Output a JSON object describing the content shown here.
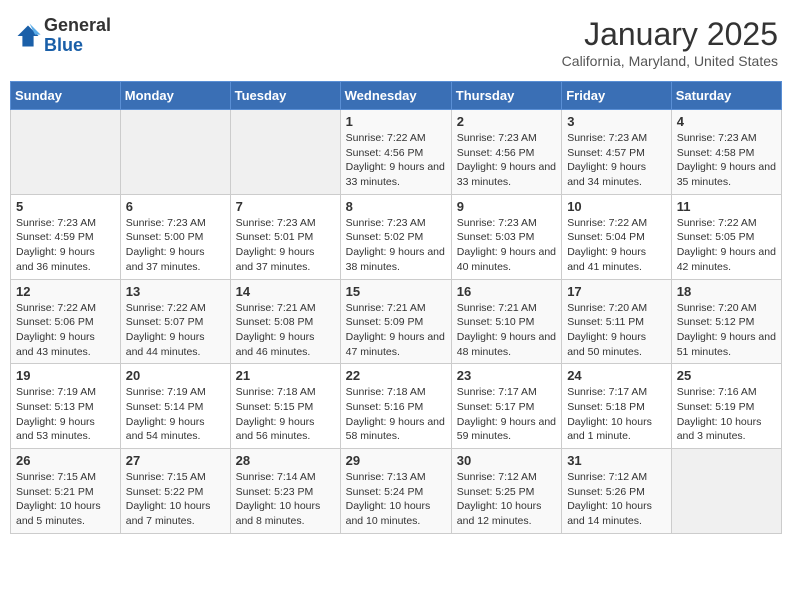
{
  "header": {
    "logo_general": "General",
    "logo_blue": "Blue",
    "month_title": "January 2025",
    "location": "California, Maryland, United States"
  },
  "weekdays": [
    "Sunday",
    "Monday",
    "Tuesday",
    "Wednesday",
    "Thursday",
    "Friday",
    "Saturday"
  ],
  "weeks": [
    [
      {
        "day": "",
        "info": ""
      },
      {
        "day": "",
        "info": ""
      },
      {
        "day": "",
        "info": ""
      },
      {
        "day": "1",
        "info": "Sunrise: 7:22 AM\nSunset: 4:56 PM\nDaylight: 9 hours and 33 minutes."
      },
      {
        "day": "2",
        "info": "Sunrise: 7:23 AM\nSunset: 4:56 PM\nDaylight: 9 hours and 33 minutes."
      },
      {
        "day": "3",
        "info": "Sunrise: 7:23 AM\nSunset: 4:57 PM\nDaylight: 9 hours and 34 minutes."
      },
      {
        "day": "4",
        "info": "Sunrise: 7:23 AM\nSunset: 4:58 PM\nDaylight: 9 hours and 35 minutes."
      }
    ],
    [
      {
        "day": "5",
        "info": "Sunrise: 7:23 AM\nSunset: 4:59 PM\nDaylight: 9 hours and 36 minutes."
      },
      {
        "day": "6",
        "info": "Sunrise: 7:23 AM\nSunset: 5:00 PM\nDaylight: 9 hours and 37 minutes."
      },
      {
        "day": "7",
        "info": "Sunrise: 7:23 AM\nSunset: 5:01 PM\nDaylight: 9 hours and 37 minutes."
      },
      {
        "day": "8",
        "info": "Sunrise: 7:23 AM\nSunset: 5:02 PM\nDaylight: 9 hours and 38 minutes."
      },
      {
        "day": "9",
        "info": "Sunrise: 7:23 AM\nSunset: 5:03 PM\nDaylight: 9 hours and 40 minutes."
      },
      {
        "day": "10",
        "info": "Sunrise: 7:22 AM\nSunset: 5:04 PM\nDaylight: 9 hours and 41 minutes."
      },
      {
        "day": "11",
        "info": "Sunrise: 7:22 AM\nSunset: 5:05 PM\nDaylight: 9 hours and 42 minutes."
      }
    ],
    [
      {
        "day": "12",
        "info": "Sunrise: 7:22 AM\nSunset: 5:06 PM\nDaylight: 9 hours and 43 minutes."
      },
      {
        "day": "13",
        "info": "Sunrise: 7:22 AM\nSunset: 5:07 PM\nDaylight: 9 hours and 44 minutes."
      },
      {
        "day": "14",
        "info": "Sunrise: 7:21 AM\nSunset: 5:08 PM\nDaylight: 9 hours and 46 minutes."
      },
      {
        "day": "15",
        "info": "Sunrise: 7:21 AM\nSunset: 5:09 PM\nDaylight: 9 hours and 47 minutes."
      },
      {
        "day": "16",
        "info": "Sunrise: 7:21 AM\nSunset: 5:10 PM\nDaylight: 9 hours and 48 minutes."
      },
      {
        "day": "17",
        "info": "Sunrise: 7:20 AM\nSunset: 5:11 PM\nDaylight: 9 hours and 50 minutes."
      },
      {
        "day": "18",
        "info": "Sunrise: 7:20 AM\nSunset: 5:12 PM\nDaylight: 9 hours and 51 minutes."
      }
    ],
    [
      {
        "day": "19",
        "info": "Sunrise: 7:19 AM\nSunset: 5:13 PM\nDaylight: 9 hours and 53 minutes."
      },
      {
        "day": "20",
        "info": "Sunrise: 7:19 AM\nSunset: 5:14 PM\nDaylight: 9 hours and 54 minutes."
      },
      {
        "day": "21",
        "info": "Sunrise: 7:18 AM\nSunset: 5:15 PM\nDaylight: 9 hours and 56 minutes."
      },
      {
        "day": "22",
        "info": "Sunrise: 7:18 AM\nSunset: 5:16 PM\nDaylight: 9 hours and 58 minutes."
      },
      {
        "day": "23",
        "info": "Sunrise: 7:17 AM\nSunset: 5:17 PM\nDaylight: 9 hours and 59 minutes."
      },
      {
        "day": "24",
        "info": "Sunrise: 7:17 AM\nSunset: 5:18 PM\nDaylight: 10 hours and 1 minute."
      },
      {
        "day": "25",
        "info": "Sunrise: 7:16 AM\nSunset: 5:19 PM\nDaylight: 10 hours and 3 minutes."
      }
    ],
    [
      {
        "day": "26",
        "info": "Sunrise: 7:15 AM\nSunset: 5:21 PM\nDaylight: 10 hours and 5 minutes."
      },
      {
        "day": "27",
        "info": "Sunrise: 7:15 AM\nSunset: 5:22 PM\nDaylight: 10 hours and 7 minutes."
      },
      {
        "day": "28",
        "info": "Sunrise: 7:14 AM\nSunset: 5:23 PM\nDaylight: 10 hours and 8 minutes."
      },
      {
        "day": "29",
        "info": "Sunrise: 7:13 AM\nSunset: 5:24 PM\nDaylight: 10 hours and 10 minutes."
      },
      {
        "day": "30",
        "info": "Sunrise: 7:12 AM\nSunset: 5:25 PM\nDaylight: 10 hours and 12 minutes."
      },
      {
        "day": "31",
        "info": "Sunrise: 7:12 AM\nSunset: 5:26 PM\nDaylight: 10 hours and 14 minutes."
      },
      {
        "day": "",
        "info": ""
      }
    ]
  ]
}
